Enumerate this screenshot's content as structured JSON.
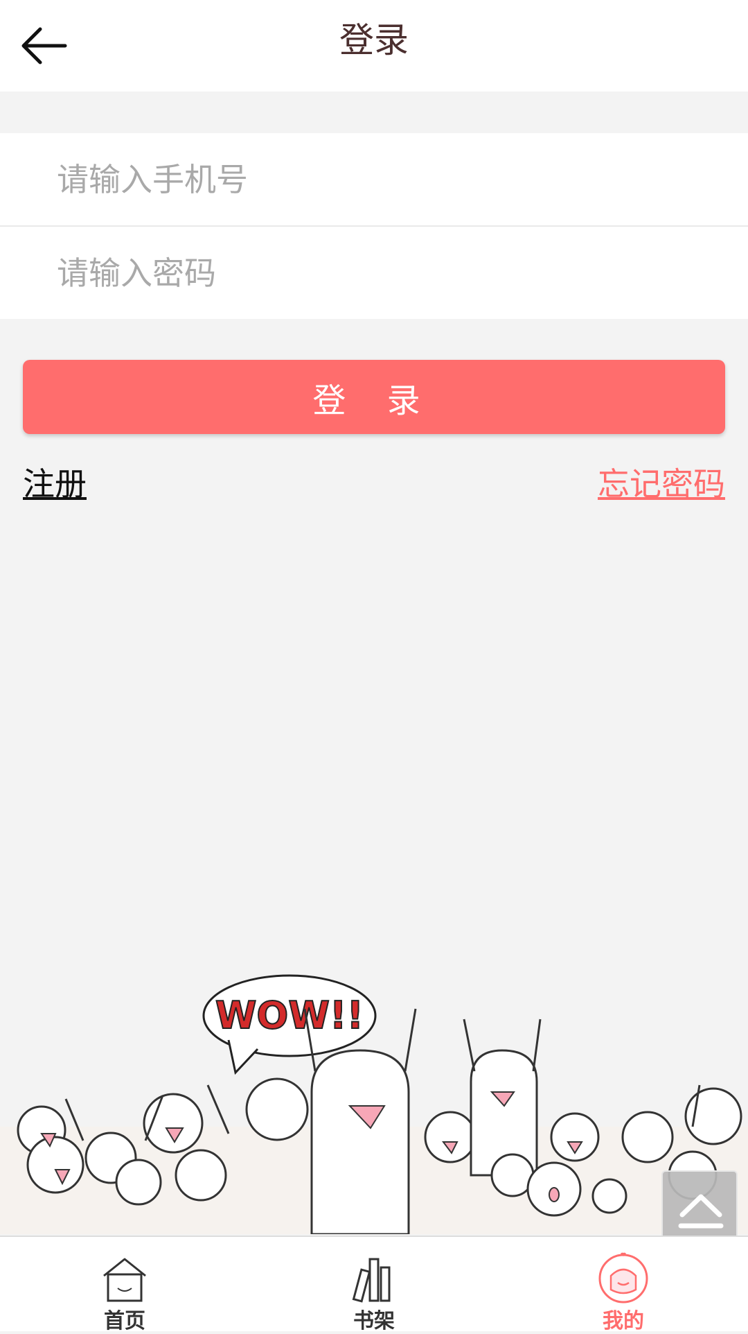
{
  "header": {
    "title": "登录",
    "back_icon": "arrow-left-icon"
  },
  "form": {
    "phone": {
      "placeholder": "请输入手机号",
      "value": ""
    },
    "password": {
      "placeholder": "请输入密码",
      "value": ""
    }
  },
  "login_button": {
    "label": "登 录"
  },
  "links": {
    "register": "注册",
    "forgot_password": "忘记密码"
  },
  "illustration": {
    "bubble_text": "WOW!!"
  },
  "tabbar": {
    "items": [
      {
        "label": "首页",
        "icon": "home-icon",
        "active": false
      },
      {
        "label": "书架",
        "icon": "bookshelf-icon",
        "active": false
      },
      {
        "label": "我的",
        "icon": "profile-icon",
        "active": true
      }
    ]
  },
  "colors": {
    "accent": "#ff6d6d",
    "background": "#f3f3f3",
    "title": "#4b2f2f"
  }
}
